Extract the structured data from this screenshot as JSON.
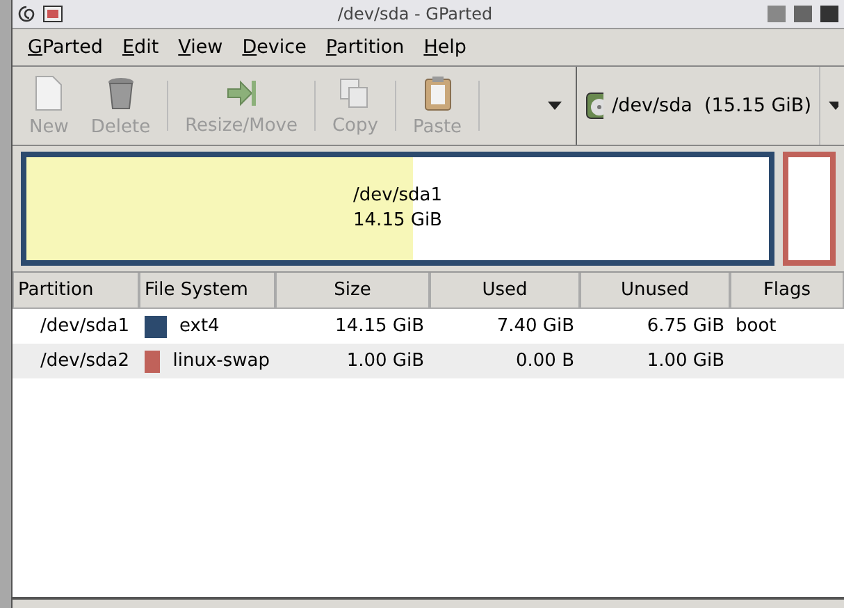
{
  "window": {
    "title": "/dev/sda - GParted"
  },
  "menu": [
    "GParted",
    "Edit",
    "View",
    "Device",
    "Partition",
    "Help"
  ],
  "toolbar": [
    {
      "kind": "new",
      "label": "New",
      "disabled": true
    },
    {
      "kind": "delete",
      "label": "Delete",
      "disabled": true
    },
    {
      "kind": "resize",
      "label": "Resize/Move",
      "disabled": true
    },
    {
      "kind": "copy",
      "label": "Copy",
      "disabled": true
    },
    {
      "kind": "paste",
      "label": "Paste",
      "disabled": true
    }
  ],
  "device": {
    "name": "/dev/sda",
    "size": "(15.15 GiB)"
  },
  "disk_map": [
    {
      "name": "/dev/sda1",
      "size": "14.15 GiB",
      "color": "#2c4a6e",
      "level": 0.52
    },
    {
      "color": "#c0625a"
    }
  ],
  "table": {
    "columns": [
      "Partition",
      "File System",
      "Size",
      "Used",
      "Unused",
      "Flags"
    ],
    "rows": [
      {
        "partition": "/dev/sda1",
        "fs": "ext4",
        "color": "#2c4a6e",
        "size": "14.15 GiB",
        "used": "7.40 GiB",
        "unused": "6.75 GiB",
        "flags": "boot"
      },
      {
        "partition": "/dev/sda2",
        "fs": "linux-swap",
        "color": "#c0625a",
        "size": "1.00 GiB",
        "used": "0.00 B",
        "unused": "1.00 GiB"
      }
    ]
  }
}
